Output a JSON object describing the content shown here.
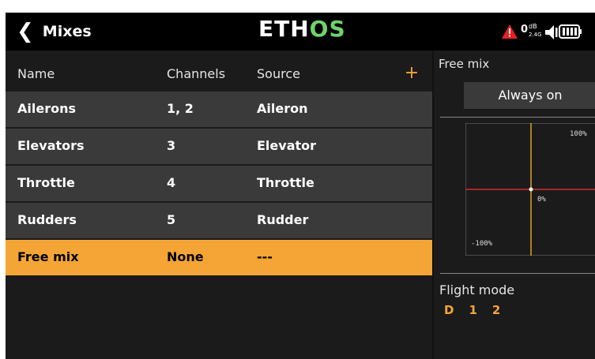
{
  "header": {
    "back_glyph": "❮",
    "title": "Mixes",
    "logo_main": "ETH",
    "logo_accent": "OS",
    "rssi_value": "0",
    "rssi_unit": "dB",
    "rssi_band": "2.4G",
    "icons": [
      "back-chevron-icon",
      "alert-triangle-icon",
      "speaker-icon",
      "battery-icon"
    ],
    "colors": {
      "logo_accent": "#6fd36a",
      "alert": "#e52222"
    }
  },
  "table": {
    "columns": [
      "Name",
      "Channels",
      "Source"
    ],
    "add_label": "+",
    "rows": [
      {
        "name": "Ailerons",
        "channels": "1, 2",
        "source": "Aileron"
      },
      {
        "name": "Elevators",
        "channels": "3",
        "source": "Elevator"
      },
      {
        "name": "Throttle",
        "channels": "4",
        "source": "Throttle"
      },
      {
        "name": "Rudders",
        "channels": "5",
        "source": "Rudder"
      },
      {
        "name": "Free mix",
        "channels": "None",
        "source": "---"
      }
    ],
    "selected_index": 4,
    "colors": {
      "row_bg": "#3a3a3a",
      "selected_bg": "#f5a535"
    }
  },
  "panel": {
    "free_mix_label": "Free mix",
    "free_mix_value": "Always on",
    "curve": {
      "top_label": "100%",
      "mid_label": "0%",
      "bottom_label": "-100%"
    },
    "flight_mode_label": "Flight mode",
    "flight_modes": [
      "D",
      "1",
      "2"
    ]
  }
}
